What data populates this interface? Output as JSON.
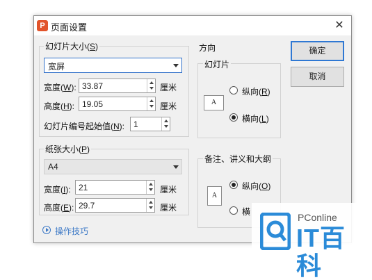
{
  "dialog": {
    "title": "页面设置",
    "app_icon_letter": "P",
    "close_glyph": "✕"
  },
  "slide_size": {
    "group_label_pre": "幻灯片大小(",
    "group_label_key": "S",
    "group_label_post": ")",
    "preset_value": "宽屏",
    "width": {
      "label_pre": "宽度(",
      "label_key": "W",
      "label_post": "):",
      "value": "33.87",
      "unit": "厘米"
    },
    "height": {
      "label_pre": "高度(",
      "label_key": "H",
      "label_post": "):",
      "value": "19.05",
      "unit": "厘米"
    },
    "start_number": {
      "label_pre": "幻灯片编号起始值(",
      "label_key": "N",
      "label_post": "):",
      "value": "1"
    }
  },
  "paper_size": {
    "group_label_pre": "纸张大小(",
    "group_label_key": "P",
    "group_label_post": ")",
    "preset_value": "A4",
    "width": {
      "label_pre": "宽度(",
      "label_key": "I",
      "label_post": "):",
      "value": "21",
      "unit": "厘米"
    },
    "height": {
      "label_pre": "高度(",
      "label_key": "E",
      "label_post": "):",
      "value": "29.7",
      "unit": "厘米"
    }
  },
  "orientation": {
    "title": "方向",
    "slides": {
      "group_label": "幻灯片",
      "icon_letter": "A",
      "portrait_pre": "纵向(",
      "portrait_key": "R",
      "portrait_post": ")",
      "portrait_checked": false,
      "landscape_pre": "横向(",
      "landscape_key": "L",
      "landscape_post": ")",
      "landscape_checked": true
    },
    "notes": {
      "group_label": "备注、讲义和大纲",
      "icon_letter": "A",
      "portrait_pre": "纵向(",
      "portrait_key": "O",
      "portrait_post": ")",
      "portrait_checked": true,
      "landscape_partial": "横",
      "landscape_checked": false
    }
  },
  "buttons": {
    "ok": "确定",
    "cancel": "取消"
  },
  "tips_link": "操作技巧",
  "watermark": {
    "brand_small": "PConline",
    "brand_big": "IT百科"
  },
  "colors": {
    "accent": "#2f78d3",
    "app_icon": "#e2542b",
    "watermark_blue": "#2b8bd8"
  }
}
